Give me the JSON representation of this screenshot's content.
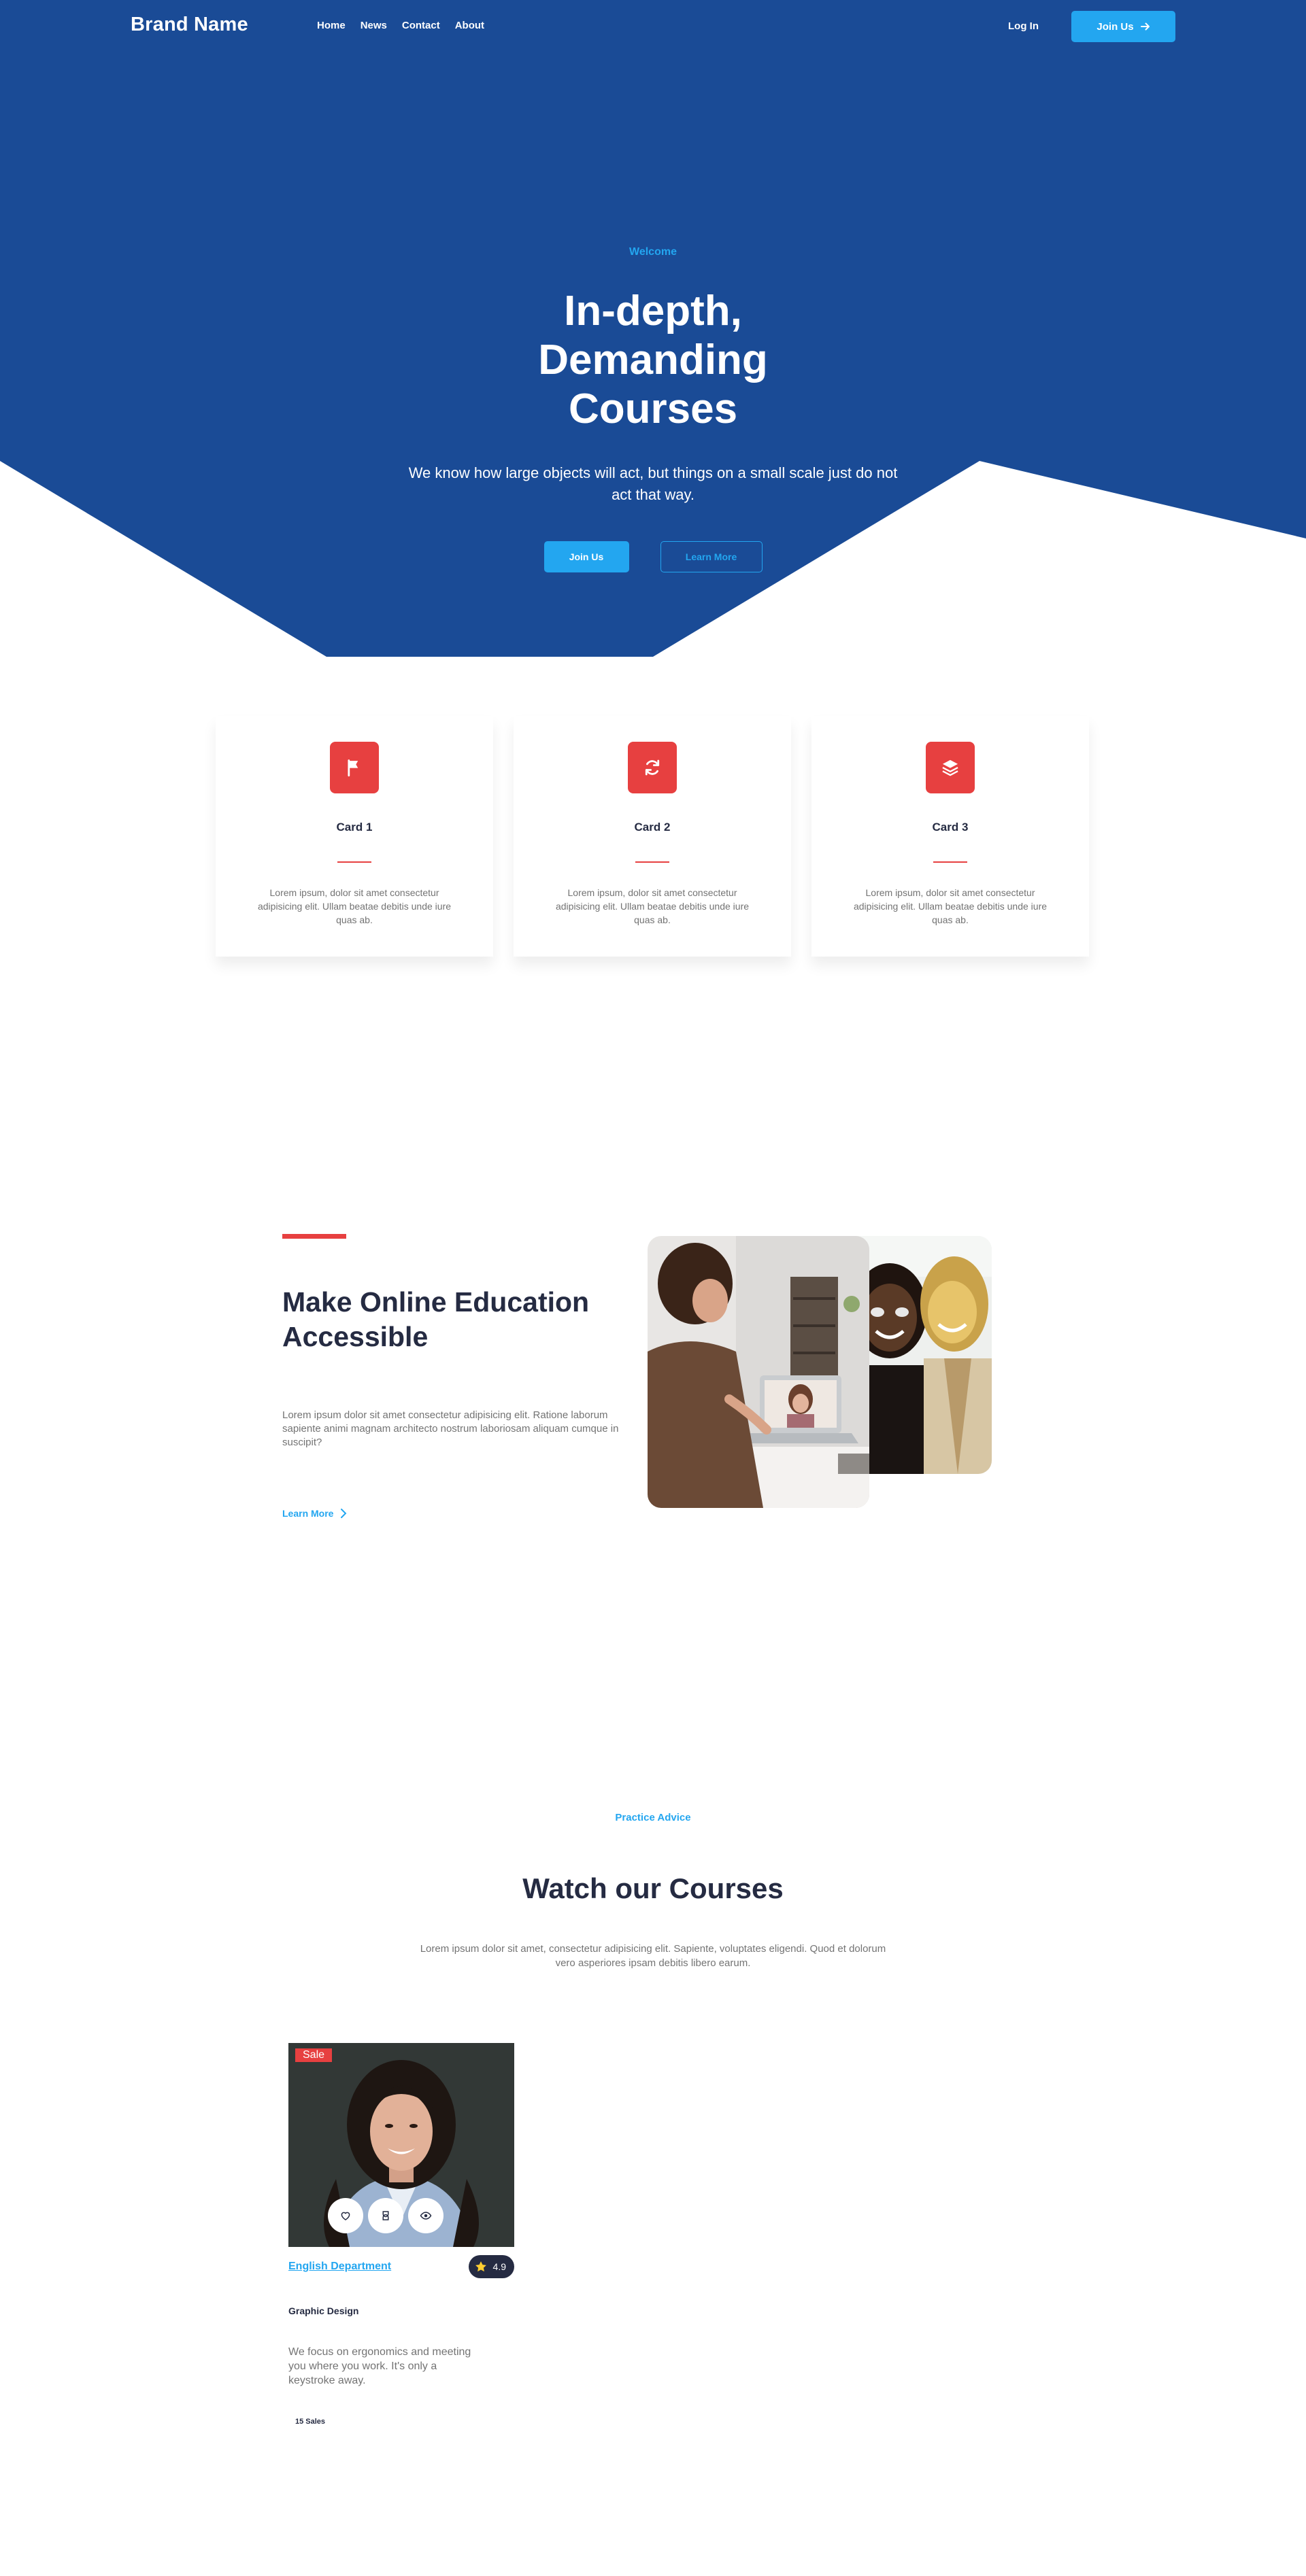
{
  "colors": {
    "primary_dark": "#1A4B96",
    "accent_blue": "#23A6F0",
    "accent_red": "#E74040",
    "text_dark": "#252B42",
    "text_muted": "#737373"
  },
  "nav": {
    "brand": "Brand Name",
    "links": [
      "Home",
      "News",
      "Contact",
      "About"
    ],
    "login_label": "Log In",
    "join_label": "Join Us"
  },
  "hero": {
    "eyebrow": "Welcome",
    "title": "In-depth, Demanding Courses",
    "text": "We know how large objects will act, but things on a small scale just do not act that way.",
    "primary_button": "Join Us",
    "secondary_button": "Learn More"
  },
  "features": [
    {
      "icon": "flag-icon",
      "title": "Card 1",
      "text": "Lorem ipsum, dolor sit amet consectetur adipisicing elit. Ullam beatae debitis unde iure quas ab."
    },
    {
      "icon": "refresh-icon",
      "title": "Card 2",
      "text": "Lorem ipsum, dolor sit amet consectetur adipisicing elit. Ullam beatae debitis unde iure quas ab."
    },
    {
      "icon": "layers-icon",
      "title": "Card 3",
      "text": "Lorem ipsum, dolor sit amet consectetur adipisicing elit. Ullam beatae debitis unde iure quas ab."
    }
  ],
  "about": {
    "title": "Make Online Education Accessible",
    "text": "Lorem ipsum dolor sit amet consectetur adipisicing elit. Ratione laborum sapiente animi magnam architecto nostrum laboriosam aliquam cumque in suscipit?",
    "link": "Learn More"
  },
  "courses": {
    "eyebrow": "Practice Advice",
    "title": "Watch our Courses",
    "text": "Lorem ipsum dolor sit amet, consectetur adipisicing elit. Sapiente, voluptates eligendi. Quod et dolorum vero asperiores ipsam debitis libero earum.",
    "items": [
      {
        "badge": "Sale",
        "department": "English Department",
        "rating": "4.9",
        "name": "Graphic Design",
        "description": "We focus on ergonomics and meeting you where you work. It's only a keystroke away.",
        "sales": "15 Sales"
      }
    ]
  }
}
